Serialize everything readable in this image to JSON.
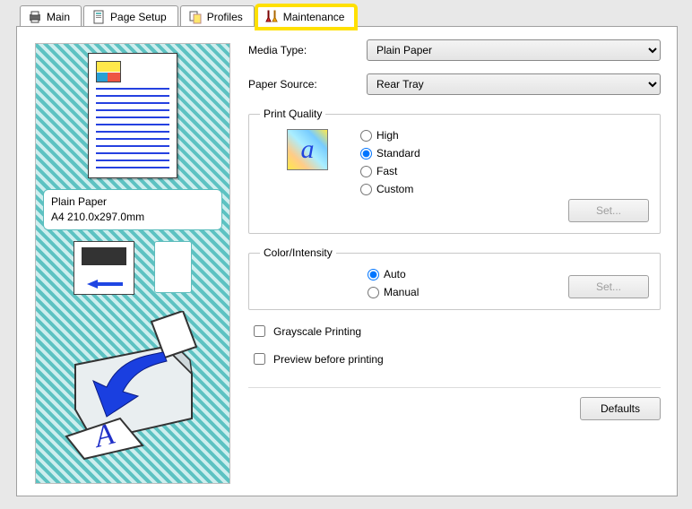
{
  "tabs": {
    "main": "Main",
    "page_setup": "Page Setup",
    "profiles": "Profiles",
    "maintenance": "Maintenance"
  },
  "fields": {
    "media_type_label": "Media Type:",
    "media_type_value": "Plain Paper",
    "paper_source_label": "Paper Source:",
    "paper_source_value": "Rear Tray"
  },
  "print_quality": {
    "legend": "Print Quality",
    "high": "High",
    "standard": "Standard",
    "fast": "Fast",
    "custom": "Custom",
    "selected": "Standard",
    "set_label": "Set..."
  },
  "color_intensity": {
    "legend": "Color/Intensity",
    "auto": "Auto",
    "manual": "Manual",
    "selected": "Auto",
    "set_label": "Set..."
  },
  "checks": {
    "grayscale": "Grayscale Printing",
    "preview": "Preview before printing"
  },
  "buttons": {
    "defaults": "Defaults"
  },
  "preview_info": {
    "line1": "Plain Paper",
    "line2": "A4 210.0x297.0mm"
  }
}
